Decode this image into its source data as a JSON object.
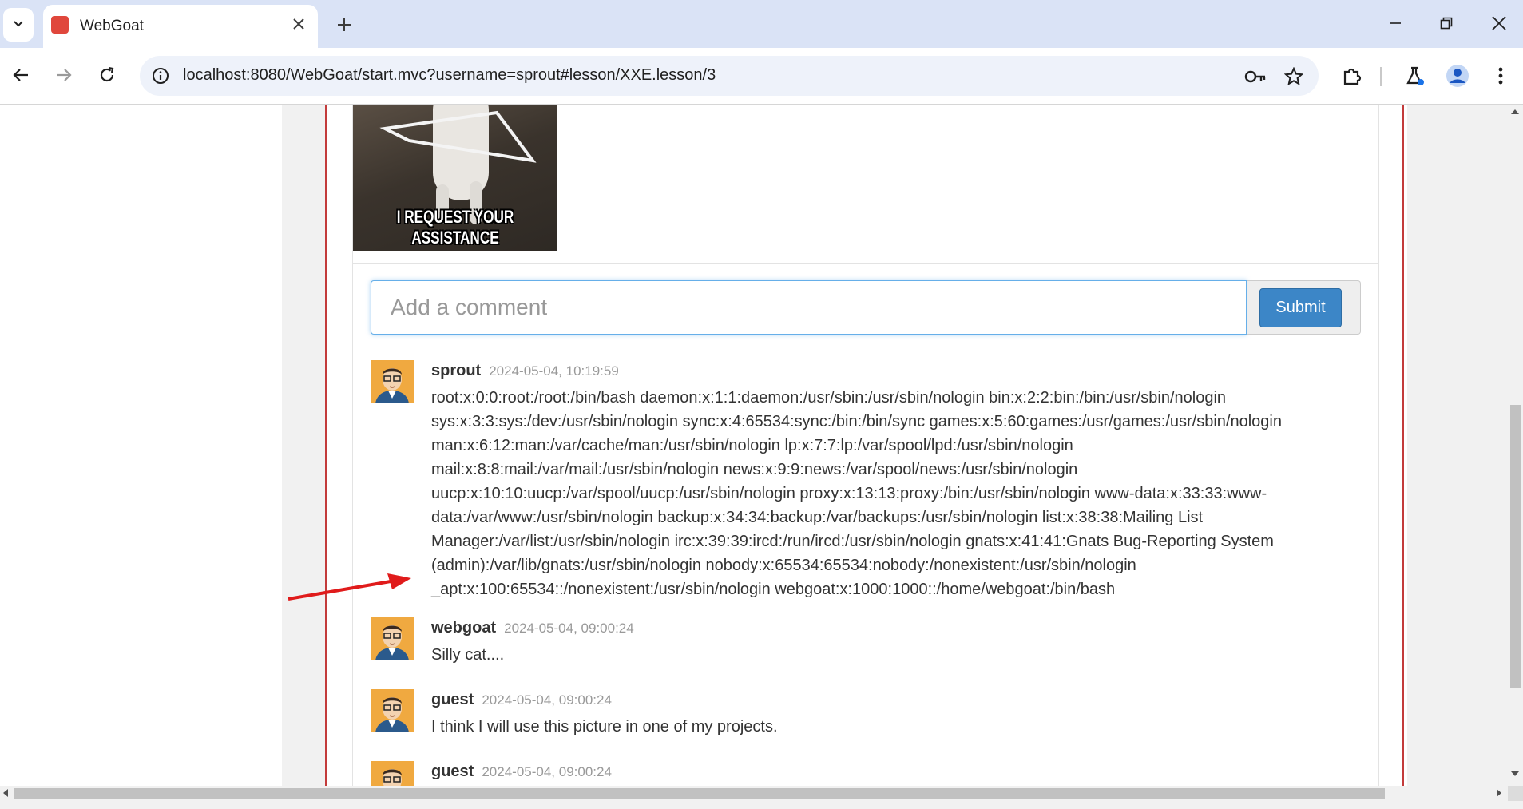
{
  "browser": {
    "tab_title": "WebGoat",
    "url": "localhost:8080/WebGoat/start.mvc?username=sprout#lesson/XXE.lesson/3"
  },
  "image": {
    "caption_line1": "I REQUEST YOUR",
    "caption_line2": "ASSISTANCE"
  },
  "comment_form": {
    "placeholder": "Add a comment",
    "submit_label": "Submit"
  },
  "comments": [
    {
      "author": "sprout",
      "date": "2024-05-04, 10:19:59",
      "text": "root:x:0:0:root:/root:/bin/bash daemon:x:1:1:daemon:/usr/sbin:/usr/sbin/nologin bin:x:2:2:bin:/bin:/usr/sbin/nologin sys:x:3:3:sys:/dev:/usr/sbin/nologin sync:x:4:65534:sync:/bin:/bin/sync games:x:5:60:games:/usr/games:/usr/sbin/nologin man:x:6:12:man:/var/cache/man:/usr/sbin/nologin lp:x:7:7:lp:/var/spool/lpd:/usr/sbin/nologin mail:x:8:8:mail:/var/mail:/usr/sbin/nologin news:x:9:9:news:/var/spool/news:/usr/sbin/nologin uucp:x:10:10:uucp:/var/spool/uucp:/usr/sbin/nologin proxy:x:13:13:proxy:/bin:/usr/sbin/nologin www-data:x:33:33:www-data:/var/www:/usr/sbin/nologin backup:x:34:34:backup:/var/backups:/usr/sbin/nologin list:x:38:38:Mailing List Manager:/var/list:/usr/sbin/nologin irc:x:39:39:ircd:/run/ircd:/usr/sbin/nologin gnats:x:41:41:Gnats Bug-Reporting System (admin):/var/lib/gnats:/usr/sbin/nologin nobody:x:65534:65534:nobody:/nonexistent:/usr/sbin/nologin _apt:x:100:65534::/nonexistent:/usr/sbin/nologin webgoat:x:1000:1000::/home/webgoat:/bin/bash"
    },
    {
      "author": "webgoat",
      "date": "2024-05-04, 09:00:24",
      "text": "Silly cat...."
    },
    {
      "author": "guest",
      "date": "2024-05-04, 09:00:24",
      "text": "I think I will use this picture in one of my projects."
    },
    {
      "author": "guest",
      "date": "2024-05-04, 09:00:24",
      "text": ""
    }
  ],
  "colors": {
    "accent": "#3c86c7",
    "annotation_arrow": "#e01b1b",
    "lesson_border": "#c33b3b"
  }
}
